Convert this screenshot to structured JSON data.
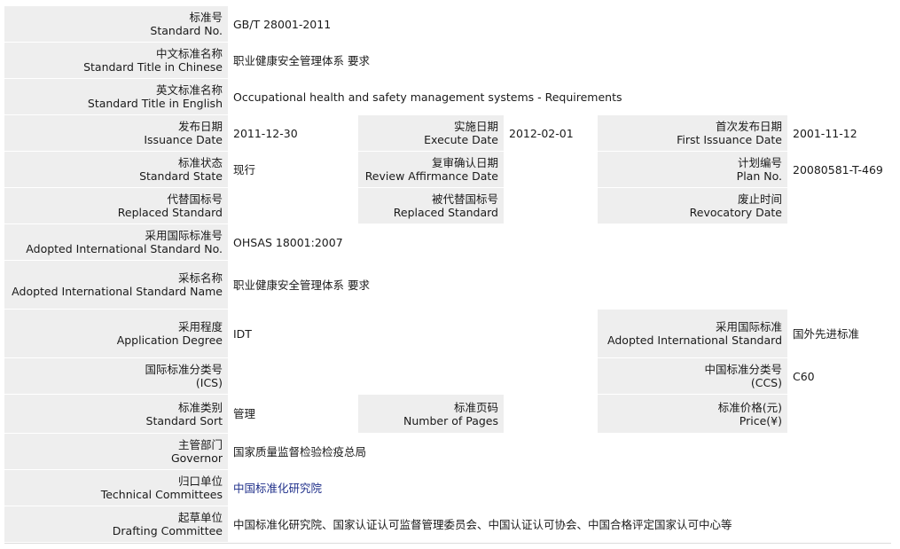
{
  "fields": {
    "standard_no": {
      "zh": "标准号",
      "en": "Standard No.",
      "value": "GB/T 28001-2011"
    },
    "title_zh": {
      "zh": "中文标准名称",
      "en": "Standard Title in Chinese",
      "value": "职业健康安全管理体系 要求"
    },
    "title_en": {
      "zh": "英文标准名称",
      "en": "Standard Title in English",
      "value": "Occupational health and safety management systems - Requirements"
    },
    "issuance_date": {
      "zh": "发布日期",
      "en": "Issuance Date",
      "value": "2011-12-30"
    },
    "execute_date": {
      "zh": "实施日期",
      "en": "Execute Date",
      "value": "2012-02-01"
    },
    "first_issuance_date": {
      "zh": "首次发布日期",
      "en": "First Issuance Date",
      "value": "2001-11-12"
    },
    "standard_state": {
      "zh": "标准状态",
      "en": "Standard State",
      "value": "现行"
    },
    "review_date": {
      "zh": "复审确认日期",
      "en": "Review Affirmance Date",
      "value": ""
    },
    "plan_no": {
      "zh": "计划编号",
      "en": "Plan No.",
      "value": "20080581-T-469"
    },
    "replaced_standard": {
      "zh": "代替国标号",
      "en": "Replaced Standard",
      "value": ""
    },
    "replaced_by": {
      "zh": "被代替国标号",
      "en": "Replaced Standard",
      "value": ""
    },
    "revocatory_date": {
      "zh": "废止时间",
      "en": "Revocatory Date",
      "value": ""
    },
    "adopted_intl_no": {
      "zh": "采用国际标准号",
      "en": "Adopted International Standard No.",
      "value": "OHSAS 18001:2007"
    },
    "adopted_intl_name": {
      "zh": "采标名称",
      "en": "Adopted International Standard Name",
      "value": "职业健康安全管理体系 要求"
    },
    "application_degree": {
      "zh": "采用程度",
      "en": "Application Degree",
      "value": "IDT"
    },
    "adopted_intl_standard": {
      "zh": "采用国际标准",
      "en": "Adopted International Standard",
      "value": "国外先进标准"
    },
    "ics": {
      "zh": "国际标准分类号",
      "en": "(ICS)",
      "value": ""
    },
    "ccs": {
      "zh": "中国标准分类号",
      "en": "(CCS)",
      "value": "C60"
    },
    "standard_sort": {
      "zh": "标准类别",
      "en": "Standard Sort",
      "value": "管理"
    },
    "number_of_pages": {
      "zh": "标准页码",
      "en": "Number of Pages",
      "value": ""
    },
    "price": {
      "zh": "标准价格(元)",
      "en": "Price(¥)",
      "value": ""
    },
    "governor": {
      "zh": "主管部门",
      "en": "Governor",
      "value": "国家质量监督检验检疫总局"
    },
    "technical_committees": {
      "zh": "归口单位",
      "en": "Technical Committees",
      "value": "中国标准化研究院"
    },
    "drafting_committee": {
      "zh": "起草单位",
      "en": "Drafting Committee",
      "value": "中国标准化研究院、国家认证认可监督管理委员会、中国认证认可协会、中国合格评定国家认可中心等"
    }
  },
  "colors": {
    "label_background": "#eeeeee",
    "link_text": "#1f2f8a"
  }
}
